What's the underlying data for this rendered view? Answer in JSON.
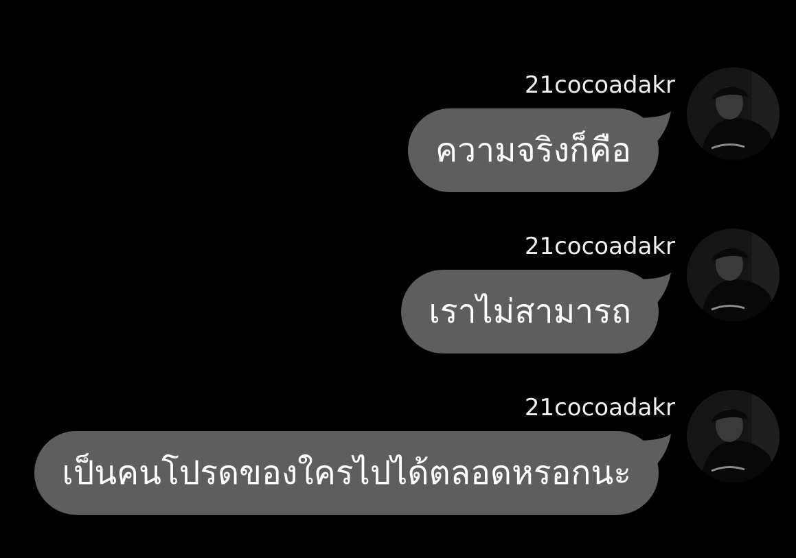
{
  "messages": [
    {
      "sender": "21cocoadakr",
      "text": "ความจริงก็คือ"
    },
    {
      "sender": "21cocoadakr",
      "text": "เราไม่สามารถ"
    },
    {
      "sender": "21cocoadakr",
      "text": "เป็นคนโปรดของใครไปได้ตลอดหรอกนะ"
    }
  ],
  "colors": {
    "background": "#000000",
    "bubble": "#5e5e5e",
    "text": "#ffffff"
  },
  "icons": {
    "avatar": "avatar-photo-icon"
  }
}
